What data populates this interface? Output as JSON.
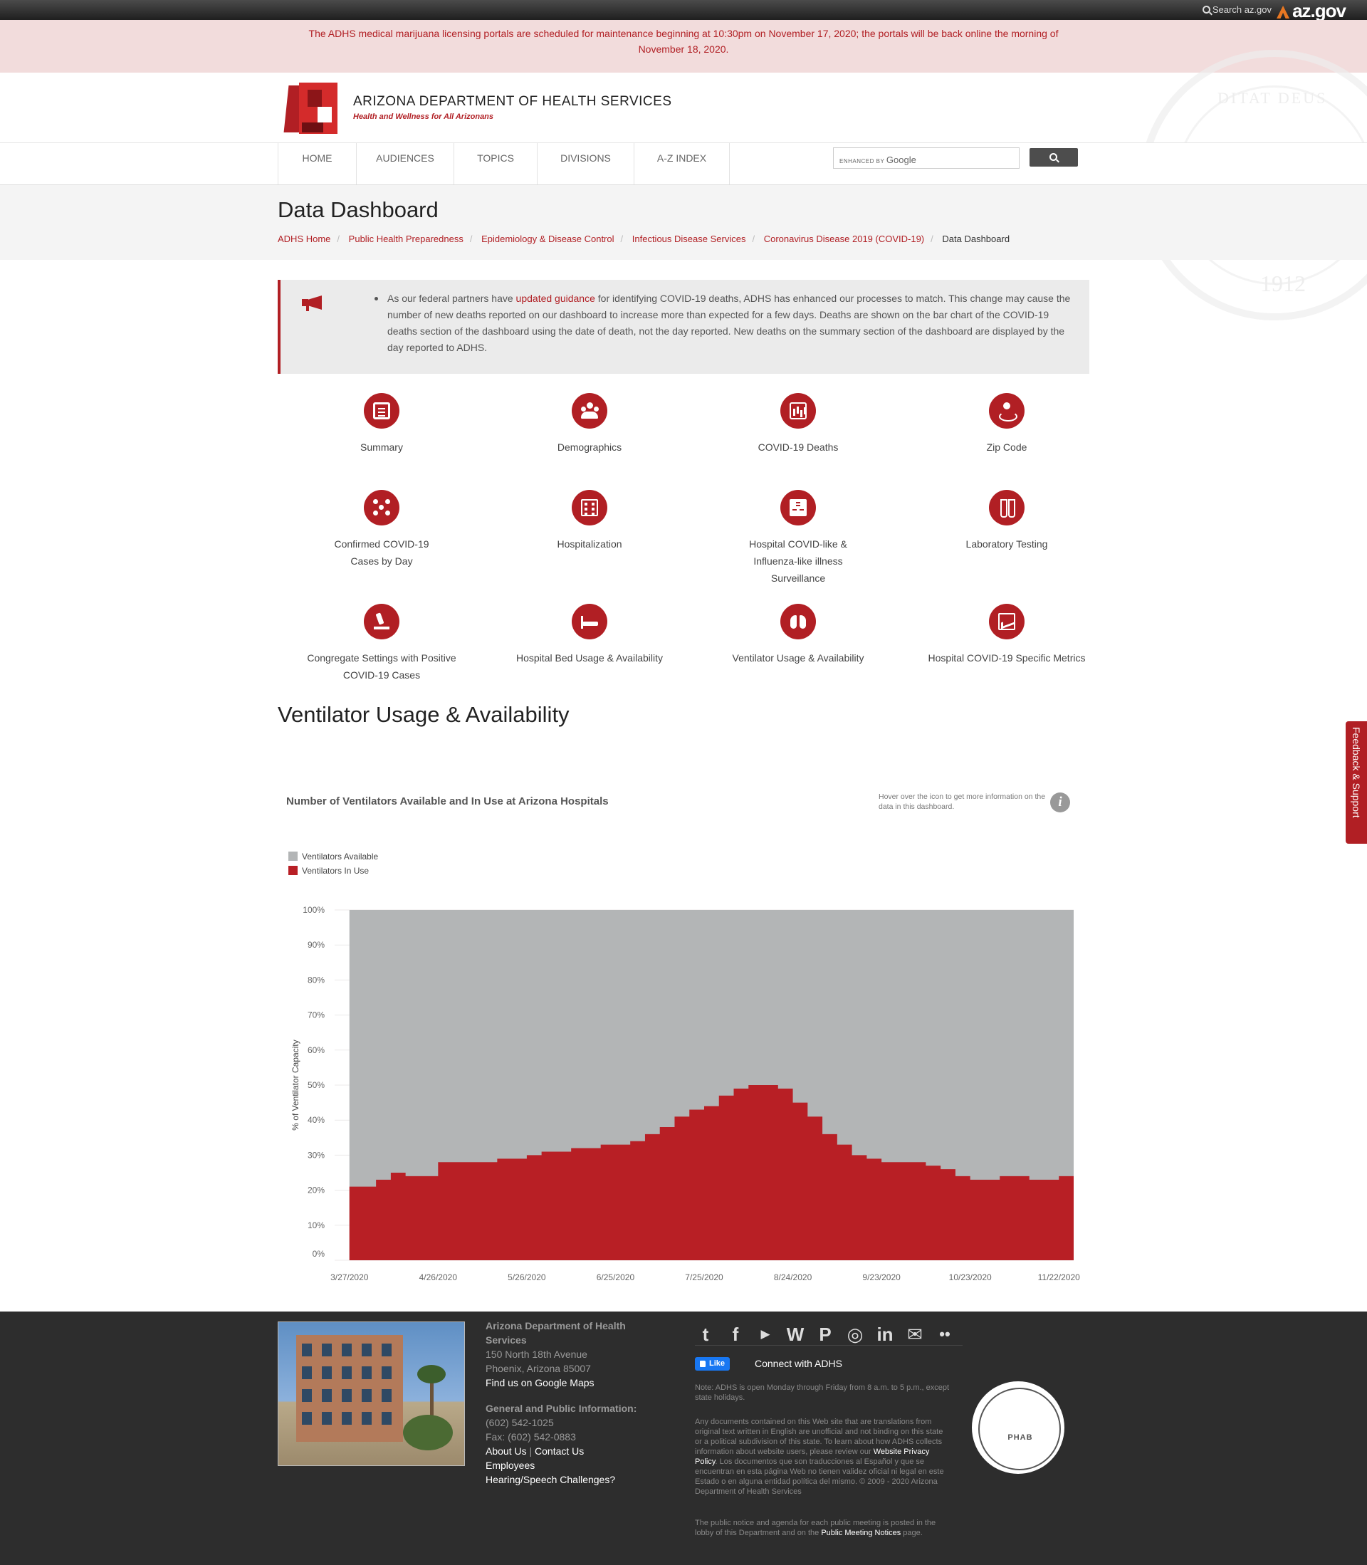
{
  "topbar": {
    "search_label": "Search az.gov",
    "brand": "az.gov"
  },
  "alert": {
    "text": "The ADHS medical marijuana licensing portals are scheduled for maintenance beginning at 10:30pm on November 17, 2020; the portals will be back online the morning of November 18, 2020."
  },
  "seal": {
    "motto": "DITAT DEUS",
    "year": "1912"
  },
  "header": {
    "org_name": "ARIZONA DEPARTMENT OF HEALTH SERVICES",
    "tagline": "Health and Wellness for All Arizonans"
  },
  "nav": {
    "items": [
      {
        "label": "HOME"
      },
      {
        "label": "AUDIENCES"
      },
      {
        "label": "TOPICS"
      },
      {
        "label": "DIVISIONS"
      },
      {
        "label": "A-Z INDEX"
      }
    ],
    "search_enhanced": "ENHANCED BY",
    "search_google": "Google"
  },
  "page": {
    "title": "Data Dashboard",
    "breadcrumbs": [
      "ADHS Home",
      "Public Health Preparedness",
      "Epidemiology & Disease Control",
      "Infectious Disease Services",
      "Coronavirus Disease 2019 (COVID-19)"
    ],
    "breadcrumb_current": "Data Dashboard"
  },
  "notice": {
    "pre": "As our federal partners have ",
    "link": "updated guidance",
    "post": " for identifying COVID-19 deaths, ADHS has enhanced our processes to match. This change may cause the number of new deaths reported on our dashboard to increase more than expected for a few days. Deaths are shown on the bar chart of the COVID-19 deaths section of the dashboard using the date of death, not the day reported. New deaths on the summary section of the dashboard are displayed by the day reported to ADHS."
  },
  "tiles": [
    {
      "label": "Summary",
      "icon": "book-icon"
    },
    {
      "label": "Demographics",
      "icon": "people-icon"
    },
    {
      "label": "COVID-19 Deaths",
      "icon": "bar-chart-icon"
    },
    {
      "label": "Zip Code",
      "icon": "location-pin-icon"
    },
    {
      "label": "Confirmed COVID-19 Cases by Day",
      "icon": "network-icon"
    },
    {
      "label": "Hospitalization",
      "icon": "hospital-icon"
    },
    {
      "label": "Hospital COVID-like & Influenza-like illness Surveillance",
      "icon": "building-icon"
    },
    {
      "label": "Laboratory Testing",
      "icon": "test-tubes-icon"
    },
    {
      "label": "Congregate Settings with Positive COVID-19 Cases",
      "icon": "microscope-icon"
    },
    {
      "label": "Hospital Bed Usage & Availability",
      "icon": "hospital-bed-icon"
    },
    {
      "label": "Ventilator Usage & Availability",
      "icon": "lungs-icon"
    },
    {
      "label": "Hospital COVID-19 Specific Metrics",
      "icon": "trend-chart-icon"
    }
  ],
  "section": {
    "title": "Ventilator Usage & Availability"
  },
  "chart_header": {
    "title": "Number of Ventilators Available and In Use at Arizona Hospitals",
    "hover_note": "Hover over the icon to get more information on the data in this dashboard.",
    "info_glyph": "i"
  },
  "chart_data": {
    "type": "area",
    "title": "Number of Ventilators Available and In Use at Arizona Hospitals",
    "ylabel": "% of Ventilator Capacity",
    "xlabel": "",
    "ylim": [
      0,
      100
    ],
    "y_ticks": [
      "0%",
      "10%",
      "20%",
      "30%",
      "40%",
      "50%",
      "60%",
      "70%",
      "80%",
      "90%",
      "100%"
    ],
    "x_ticks": [
      "3/27/2020",
      "4/26/2020",
      "5/26/2020",
      "6/25/2020",
      "7/25/2020",
      "8/24/2020",
      "9/23/2020",
      "10/23/2020",
      "11/22/2020"
    ],
    "x_range": [
      "2020-03-22",
      "2020-11-27"
    ],
    "stacked": true,
    "legend_position": "top-left",
    "grid": true,
    "colors": {
      "available": "#b3b5b6",
      "in_use": "#b81f25"
    },
    "series": [
      {
        "name": "Ventilators In Use",
        "x": [
          "2020-03-27",
          "2020-04-01",
          "2020-04-05",
          "2020-04-10",
          "2020-04-15",
          "2020-04-20",
          "2020-04-26",
          "2020-05-01",
          "2020-05-06",
          "2020-05-11",
          "2020-05-16",
          "2020-05-21",
          "2020-05-26",
          "2020-05-31",
          "2020-06-05",
          "2020-06-10",
          "2020-06-15",
          "2020-06-20",
          "2020-06-25",
          "2020-06-30",
          "2020-07-05",
          "2020-07-10",
          "2020-07-15",
          "2020-07-20",
          "2020-07-25",
          "2020-07-30",
          "2020-08-04",
          "2020-08-09",
          "2020-08-14",
          "2020-08-19",
          "2020-08-24",
          "2020-08-29",
          "2020-09-03",
          "2020-09-08",
          "2020-09-13",
          "2020-09-18",
          "2020-09-23",
          "2020-09-28",
          "2020-10-03",
          "2020-10-08",
          "2020-10-13",
          "2020-10-18",
          "2020-10-23",
          "2020-10-28",
          "2020-11-02",
          "2020-11-07",
          "2020-11-12",
          "2020-11-17",
          "2020-11-22",
          "2020-11-27"
        ],
        "values": [
          21,
          21,
          23,
          25,
          24,
          24,
          28,
          28,
          28,
          28,
          29,
          29,
          30,
          31,
          31,
          32,
          32,
          33,
          33,
          34,
          36,
          38,
          41,
          43,
          44,
          47,
          49,
          50,
          50,
          49,
          45,
          41,
          36,
          33,
          30,
          29,
          28,
          28,
          28,
          27,
          26,
          24,
          23,
          23,
          24,
          24,
          23,
          23,
          24,
          24
        ]
      },
      {
        "name": "Ventilators Available",
        "x": [
          "2020-03-27",
          "2020-11-27"
        ],
        "values": [
          100,
          100
        ]
      }
    ]
  },
  "feedback": {
    "label": "Feedback & Support"
  },
  "footer": {
    "org": "Arizona Department of Health Services",
    "street": "150 North 18th Avenue",
    "city": "Phoenix, Arizona 85007",
    "map_link": "Find us on Google Maps",
    "info_heading": "General and Public Information:",
    "phone": "(602) 542-1025",
    "fax": "Fax: (602) 542-0883",
    "about": "About Us",
    "pipe": "|",
    "contact": "Contact Us",
    "employees": "Employees",
    "hearing": "Hearing/Speech Challenges?",
    "fb_like": "Like",
    "connect": "Connect with ADHS",
    "hours_note": "Note: ADHS is open Monday through Friday from 8 a.m. to 5 p.m., except state holidays.",
    "translation_pre": "Any documents contained on this Web site that are translations from original text written in English are unofficial and not binding on this state or a political subdivision of this state. To learn about how ADHS collects information about website users, please review our ",
    "privacy_link": "Website Privacy Policy",
    "translation_post": ". Los documentos que son traducciones al Español y que se encuentran en esta página Web no tienen validez oficial ni legal en este Estado o en alguna entidad política del mismo. © 2009 - 2020 Arizona Department of Health Services",
    "meeting_pre": "The public notice and agenda for each public meeting is posted in the lobby of this Department and on the ",
    "meeting_link": "Public Meeting Notices",
    "meeting_post": " page.",
    "phab_text": "PHAB",
    "social": [
      {
        "icon": "twitter-icon",
        "glyph": "t"
      },
      {
        "icon": "facebook-icon",
        "glyph": "f"
      },
      {
        "icon": "youtube-icon",
        "glyph": "▶"
      },
      {
        "icon": "wordpress-icon",
        "glyph": "W"
      },
      {
        "icon": "pinterest-icon",
        "glyph": "P"
      },
      {
        "icon": "instagram-icon",
        "glyph": "◎"
      },
      {
        "icon": "linkedin-icon",
        "glyph": "in"
      },
      {
        "icon": "email-icon",
        "glyph": "✉"
      },
      {
        "icon": "flickr-icon",
        "glyph": "••"
      }
    ]
  }
}
